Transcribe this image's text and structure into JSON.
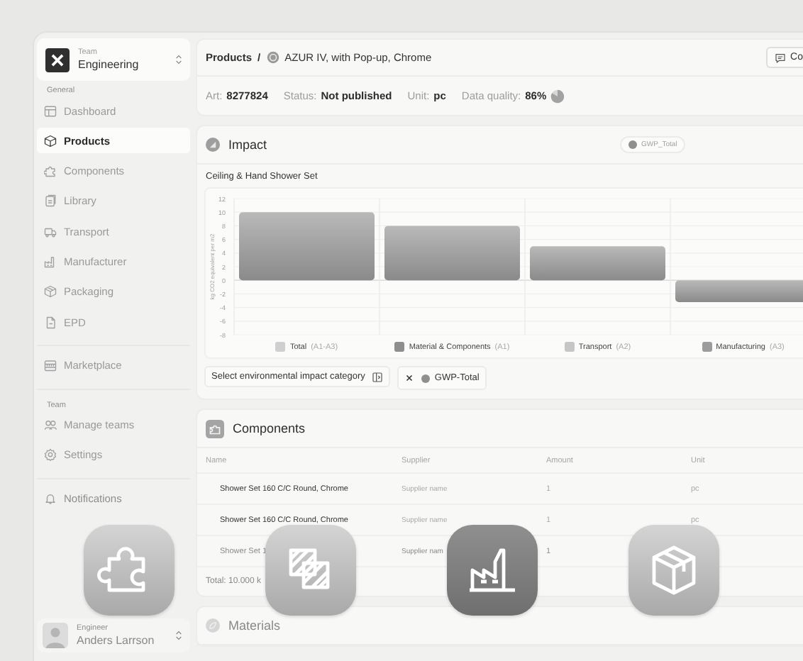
{
  "sidebar": {
    "team_switcher": {
      "label": "Team",
      "name": "Engineering"
    },
    "sections": [
      {
        "heading": "General",
        "items": [
          {
            "label": "Dashboard",
            "selected": false
          },
          {
            "label": "Products",
            "selected": true
          },
          {
            "label": "Components",
            "selected": false
          },
          {
            "label": "Library",
            "selected": false
          },
          {
            "label": "Transport",
            "selected": false
          },
          {
            "label": "Manufacturer",
            "selected": false
          },
          {
            "label": "Packaging",
            "selected": false
          },
          {
            "label": "EPD",
            "selected": false
          }
        ]
      },
      {
        "items": [
          {
            "label": "Marketplace",
            "selected": false
          }
        ]
      },
      {
        "heading": "Team",
        "items": [
          {
            "label": "Manage teams",
            "selected": false
          },
          {
            "label": "Settings",
            "selected": false
          }
        ]
      },
      {
        "items": [
          {
            "label": "Notifications",
            "selected": false
          }
        ]
      }
    ],
    "user": {
      "role": "Engineer",
      "name": "Anders Larrson"
    }
  },
  "header": {
    "parent": "Products",
    "separator": "/",
    "current": "AZUR IV, with Pop-up, Chrome",
    "button": "Co",
    "meta": [
      {
        "label": "Art:",
        "value": "8277824"
      },
      {
        "label": "Status:",
        "value": "Not published"
      },
      {
        "label": "Unit:",
        "value": "pc"
      },
      {
        "label": "Data quality:",
        "value": "86%"
      }
    ]
  },
  "impact": {
    "title": "Impact",
    "badge": "GWP_Total",
    "subtitle": "Ceiling & Hand Shower Set",
    "chart_data": {
      "type": "bar",
      "ylabel": "kg CO2 equivalent per m2",
      "categories": [
        "Total",
        "Material & Components",
        "Transport",
        "Manufacturing"
      ],
      "values": [
        10,
        8,
        5,
        -3.2
      ],
      "grid": true,
      "ylim": [
        -8,
        12
      ],
      "yticks": [
        12,
        10,
        8,
        6,
        4,
        2,
        0,
        -2,
        -4,
        -6,
        -8
      ]
    },
    "legend": [
      {
        "code": "(A1-A3)",
        "color": "#cfcfcf"
      },
      {
        "code": "(A1)",
        "color": "#8e8e8e"
      },
      {
        "code": "(A2)",
        "color": "#c6c6c6"
      },
      {
        "code": "(A3)",
        "color": "#9c9c9c"
      }
    ],
    "category_button": "Select environmental impact category",
    "filter_chip": "GWP-Total"
  },
  "components": {
    "title": "Components",
    "columns": [
      "Name",
      "Supplier",
      "Amount",
      "Unit"
    ],
    "rows": [
      [
        "Shower Set 160 C/C Round, Chrome",
        "Supplier name",
        "1",
        "pc"
      ],
      [
        "Shower Set 160 C/C Round, Chrome",
        "Supplier name",
        "1",
        "pc"
      ],
      [
        "Shower Set 1",
        "Supplier nam",
        "1"
      ]
    ],
    "total": "Total: 10.000 k"
  },
  "materials": {
    "title": "Materials"
  },
  "tiles": [
    {
      "selected": false
    },
    {
      "selected": false
    },
    {
      "selected": true
    },
    {
      "selected": false
    }
  ]
}
